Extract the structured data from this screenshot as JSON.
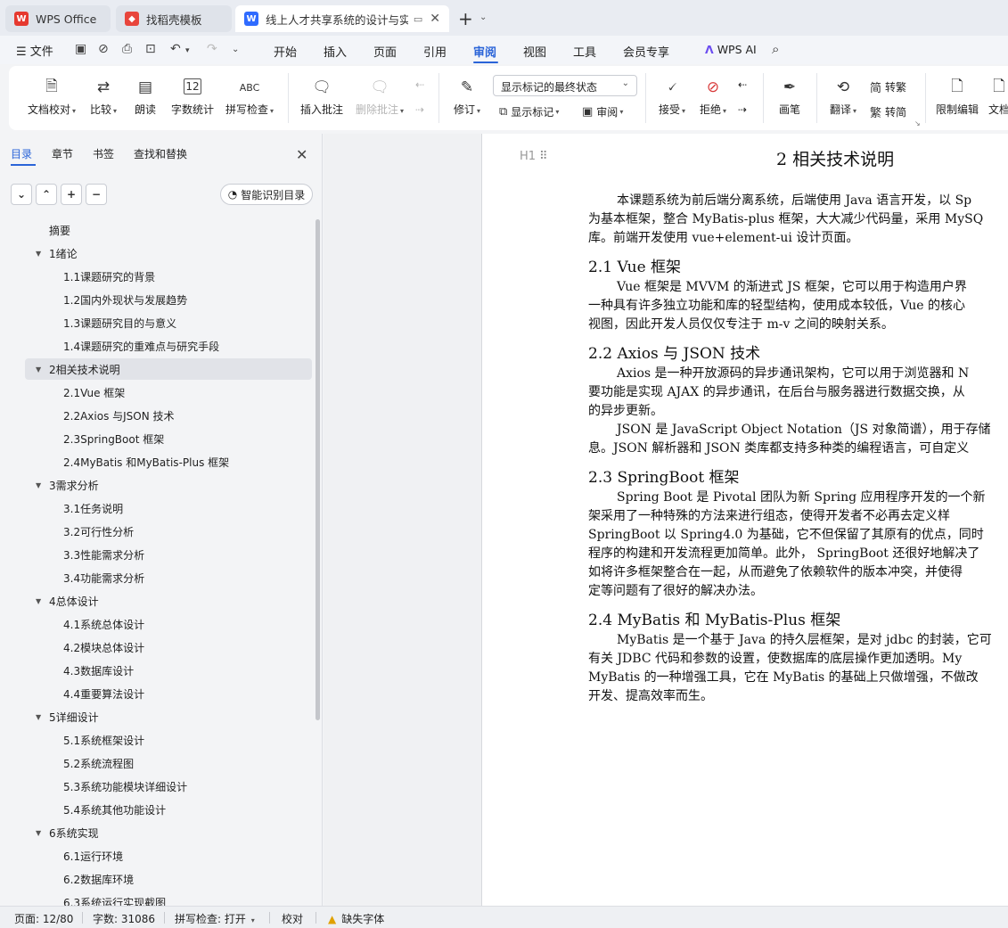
{
  "tabs": [
    {
      "label": "WPS Office",
      "icon": "wps-logo-icon"
    },
    {
      "label": "找稻壳模板",
      "icon": "docer-logo-icon"
    },
    {
      "label": "线上人才共享系统的设计与实现",
      "icon": "writer-logo-icon"
    }
  ],
  "menu": {
    "file": "文件",
    "items": [
      "开始",
      "插入",
      "页面",
      "引用",
      "审阅",
      "视图",
      "工具",
      "会员专享"
    ],
    "active": "审阅",
    "ai": "WPS AI"
  },
  "ribbon": {
    "doc_check": "文档校对",
    "compare": "比较",
    "read_aloud": "朗读",
    "word_count": "字数统计",
    "word_count_icon_text": "12",
    "spell_check": "拼写检查",
    "spell_icon_text": "ABC",
    "insert_comment": "插入批注",
    "delete_comment": "删除批注",
    "track_changes": "修订",
    "markup_select": "显示标记的最终状态",
    "show_markup": "显示标记",
    "review": "审阅",
    "accept": "接受",
    "reject": "拒绝",
    "pen": "画笔",
    "translate": "翻译",
    "to_traditional": "转繁",
    "to_simplified": "转简",
    "restrict_edit": "限制编辑",
    "doc_partial": "文档"
  },
  "nav": {
    "tabs": [
      "目录",
      "章节",
      "书签",
      "查找和替换"
    ],
    "smart_toc": "智能识别目录",
    "toc": [
      {
        "label": "摘要",
        "level": 1,
        "expandable": false,
        "selected": false
      },
      {
        "label": "1绪论",
        "level": 1,
        "expandable": true,
        "selected": false
      },
      {
        "label": "1.1课题研究的背景",
        "level": 2,
        "expandable": false,
        "selected": false
      },
      {
        "label": "1.2国内外现状与发展趋势",
        "level": 2,
        "expandable": false,
        "selected": false
      },
      {
        "label": "1.3课题研究目的与意义",
        "level": 2,
        "expandable": false,
        "selected": false
      },
      {
        "label": "1.4课题研究的重难点与研究手段",
        "level": 2,
        "expandable": false,
        "selected": false
      },
      {
        "label": "2相关技术说明",
        "level": 1,
        "expandable": true,
        "selected": true
      },
      {
        "label": "2.1Vue 框架",
        "level": 2,
        "expandable": false,
        "selected": false
      },
      {
        "label": "2.2Axios 与JSON 技术",
        "level": 2,
        "expandable": false,
        "selected": false
      },
      {
        "label": "2.3SpringBoot 框架",
        "level": 2,
        "expandable": false,
        "selected": false
      },
      {
        "label": "2.4MyBatis 和MyBatis-Plus 框架",
        "level": 2,
        "expandable": false,
        "selected": false
      },
      {
        "label": "3需求分析",
        "level": 1,
        "expandable": true,
        "selected": false
      },
      {
        "label": "3.1任务说明",
        "level": 2,
        "expandable": false,
        "selected": false
      },
      {
        "label": "3.2可行性分析",
        "level": 2,
        "expandable": false,
        "selected": false
      },
      {
        "label": "3.3性能需求分析",
        "level": 2,
        "expandable": false,
        "selected": false
      },
      {
        "label": "3.4功能需求分析",
        "level": 2,
        "expandable": false,
        "selected": false
      },
      {
        "label": "4总体设计",
        "level": 1,
        "expandable": true,
        "selected": false
      },
      {
        "label": "4.1系统总体设计",
        "level": 2,
        "expandable": false,
        "selected": false
      },
      {
        "label": "4.2模块总体设计",
        "level": 2,
        "expandable": false,
        "selected": false
      },
      {
        "label": "4.3数据库设计",
        "level": 2,
        "expandable": false,
        "selected": false
      },
      {
        "label": "4.4重要算法设计",
        "level": 2,
        "expandable": false,
        "selected": false
      },
      {
        "label": "5详细设计",
        "level": 1,
        "expandable": true,
        "selected": false
      },
      {
        "label": "5.1系统框架设计",
        "level": 2,
        "expandable": false,
        "selected": false
      },
      {
        "label": "5.2系统流程图",
        "level": 2,
        "expandable": false,
        "selected": false
      },
      {
        "label": "5.3系统功能模块详细设计",
        "level": 2,
        "expandable": false,
        "selected": false
      },
      {
        "label": "5.4系统其他功能设计",
        "level": 2,
        "expandable": false,
        "selected": false
      },
      {
        "label": "6系统实现",
        "level": 1,
        "expandable": true,
        "selected": false
      },
      {
        "label": "6.1运行环境",
        "level": 2,
        "expandable": false,
        "selected": false
      },
      {
        "label": "6.2数据库环境",
        "level": 2,
        "expandable": false,
        "selected": false
      },
      {
        "label": "6.3系统运行实现截图",
        "level": 2,
        "expandable": false,
        "selected": false
      }
    ]
  },
  "document": {
    "heading_marker": "H1",
    "chapter_title": "2  相关技术说明",
    "blocks": [
      {
        "type": "p",
        "indent": true,
        "text": "本课题系统为前后端分离系统，后端使用 Java 语言开发，以 Sp"
      },
      {
        "type": "p",
        "indent": false,
        "text": "为基本框架，整合 MyBatis-plus 框架，大大减少代码量，采用 MySQ"
      },
      {
        "type": "p",
        "indent": false,
        "text": "库。前端开发使用 vue+element-ui 设计页面。"
      },
      {
        "type": "h",
        "text": "2.1 Vue 框架"
      },
      {
        "type": "p",
        "indent": true,
        "text": "Vue 框架是 MVVM 的渐进式 JS 框架，它可以用于构造用户界"
      },
      {
        "type": "p",
        "indent": false,
        "text": "一种具有许多独立功能和库的轻型结构，使用成本较低，Vue 的核心"
      },
      {
        "type": "p",
        "indent": false,
        "text": "视图，因此开发人员仅仅专注于 m-v 之间的映射关系。"
      },
      {
        "type": "h",
        "text": "2.2 Axios 与 JSON 技术"
      },
      {
        "type": "p",
        "indent": true,
        "text": "Axios 是一种开放源码的异步通讯架构，它可以用于浏览器和 N"
      },
      {
        "type": "p",
        "indent": false,
        "text": "要功能是实现 AJAX 的异步通讯，在后台与服务器进行数据交换，从"
      },
      {
        "type": "p",
        "indent": false,
        "text": "的异步更新。"
      },
      {
        "type": "p",
        "indent": true,
        "text": "JSON 是 JavaScript Object Notation（JS 对象简谱），用于存储"
      },
      {
        "type": "p",
        "indent": false,
        "text": "息。JSON 解析器和 JSON 类库都支持多种类的编程语言，可自定义"
      },
      {
        "type": "h",
        "text": "2.3 SpringBoot 框架"
      },
      {
        "type": "p",
        "indent": true,
        "text": "Spring Boot 是 Pivotal 团队为新 Spring 应用程序开发的一个新"
      },
      {
        "type": "p",
        "indent": false,
        "text": "架采用了一种特殊的方法来进行组态，使得开发者不必再去定义样"
      },
      {
        "type": "p",
        "indent": false,
        "text": "SpringBoot 以 Spring4.0 为基础，它不但保留了其原有的优点，同时"
      },
      {
        "type": "p",
        "indent": false,
        "text": "程序的构建和开发流程更加简单。此外， SpringBoot 还很好地解决了"
      },
      {
        "type": "p",
        "indent": false,
        "text": "如将许多框架整合在一起，从而避免了依赖软件的版本冲突，并使得"
      },
      {
        "type": "p",
        "indent": false,
        "text": "定等问题有了很好的解决办法。"
      },
      {
        "type": "h",
        "text": "2.4 MyBatis 和 MyBatis-Plus 框架"
      },
      {
        "type": "p",
        "indent": true,
        "text": "MyBatis 是一个基于 Java 的持久层框架，是对 jdbc 的封装，它可"
      },
      {
        "type": "p",
        "indent": false,
        "text": "有关 JDBC 代码和参数的设置，使数据库的底层操作更加透明。My"
      },
      {
        "type": "p",
        "indent": false,
        "text": "MyBatis 的一种增强工具，它在 MyBatis 的基础上只做增强，不做改"
      },
      {
        "type": "p",
        "indent": false,
        "text": "开发、提高效率而生。"
      }
    ]
  },
  "status": {
    "page": "页面: 12/80",
    "words": "字数: 31086",
    "spell": "拼写检查: 打开",
    "proof": "校对",
    "missing_font": "缺失字体"
  },
  "colors": {
    "accent": "#2a64d8",
    "wps_red": "#e6392f",
    "writer_blue": "#2f6bff",
    "docer_red": "#e8453c"
  }
}
